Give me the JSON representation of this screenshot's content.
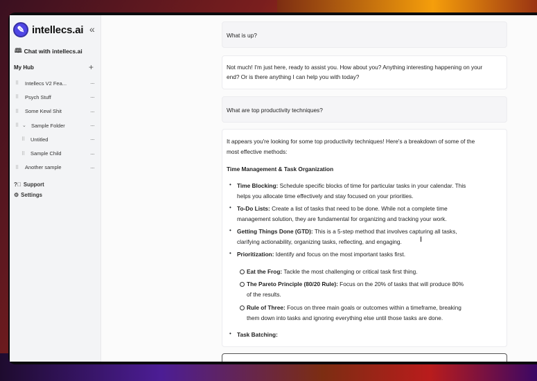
{
  "sidebar": {
    "brand": "intellecs.ai",
    "chat_link": "Chat with intellecs.ai",
    "hub_title": "My Hub",
    "items": [
      {
        "label": "Intellecs V2 Fea..."
      },
      {
        "label": "Psych Stuff"
      },
      {
        "label": "Some Kewl Shit"
      },
      {
        "label": "Sample Folder"
      },
      {
        "label": "Untitled"
      },
      {
        "label": "Sample Child"
      },
      {
        "label": "Another sample"
      }
    ],
    "support": "Support",
    "settings": "Settings"
  },
  "chat": {
    "q1": "What is up?",
    "a1_line1": "Not much! I'm just here, ready to assist you. How about you? Anything interesting happening on your",
    "a1_line2": "end? Or is there anything I can help you with today?",
    "q2": "What are top productivity techniques?",
    "a2": {
      "intro_1": "It appears you're looking for some top productivity techniques! Here's a breakdown of some of the",
      "intro_2": "most effective methods:",
      "heading": "Time Management & Task Organization",
      "b1_title": "Time Blocking:",
      "b1_text_1": " Schedule specific blocks of time for particular tasks in your calendar. This",
      "b1_text_2": "helps you allocate time effectively and stay focused on your priorities.",
      "b2_title": "To-Do Lists:",
      "b2_text_1": " Create a list of tasks that need to be done. While not a complete time",
      "b2_text_2": "management solution, they are fundamental for organizing and tracking your work.",
      "b3_title": "Getting Things Done (GTD):",
      "b3_text_1": " This is a 5-step method that involves capturing all tasks,",
      "b3_text_2": "clarifying actionability, organizing tasks, reflecting, and engaging.",
      "b4_title": "Prioritization:",
      "b4_text": " Identify and focus on the most important tasks first.",
      "s1_title": "Eat the Frog:",
      "s1_text": " Tackle the most challenging or critical task first thing.",
      "s2_title": "The Pareto Principle (80/20 Rule):",
      "s2_text_1": " Focus on the 20% of tasks that will produce 80%",
      "s2_text_2": "of the results.",
      "s3_title": "Rule of Three:",
      "s3_text_1": " Focus on three main goals or outcomes within a timeframe, breaking",
      "s3_text_2": "them down into tasks and ignoring everything else until those tasks are done.",
      "b5_title": "Task Batching:"
    }
  }
}
